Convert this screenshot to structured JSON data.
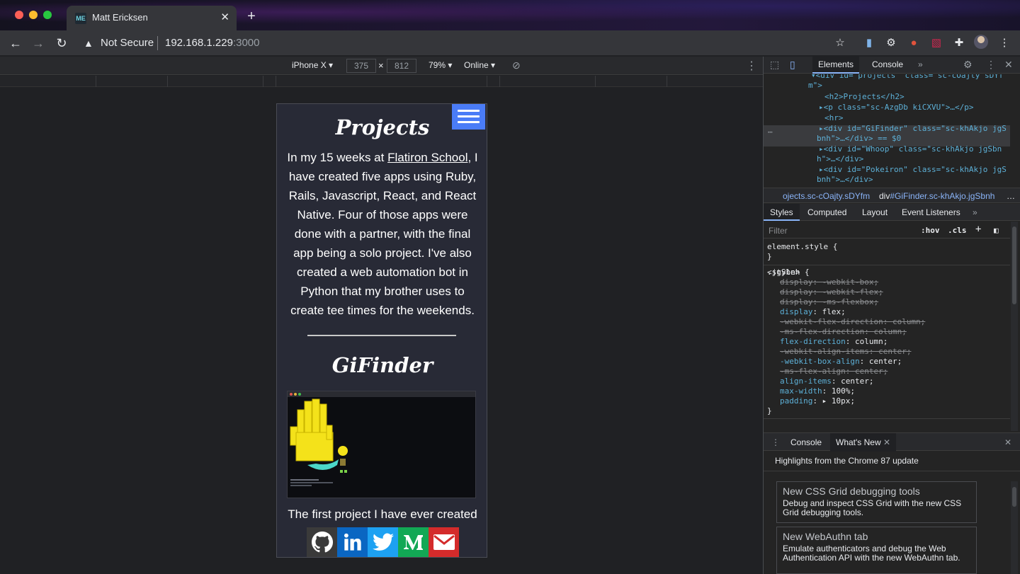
{
  "browser": {
    "tab_title": "Matt Ericksen",
    "tab_favicon": "ME",
    "security_label": "Not Secure",
    "url_host": "192.168.1.229",
    "url_port": ":3000"
  },
  "device_toolbar": {
    "device": "iPhone X",
    "width": "375",
    "height": "812",
    "zoom": "79%",
    "network": "Online"
  },
  "page": {
    "projects_title": "Projects",
    "projects_intro_before": "In my 15 weeks at ",
    "projects_link": "Flatiron School",
    "projects_intro_after": ", I have created five apps using Ruby, Rails, Javascript, React, and React Native. Four of those apps were done with a partner, with the final app being a solo project. I've also created a web automation bot in Python that my brother uses to create tee times for the weekends.",
    "gifinder_title": "GiFinder",
    "gifinder_text": "The first project I have ever created was ... this a ... y",
    "share_icons": [
      "github-icon",
      "linkedin-icon",
      "twitter-icon",
      "medium-icon",
      "email-icon"
    ]
  },
  "devtools": {
    "tabs": [
      "Elements",
      "Console"
    ],
    "active_tab": "Elements",
    "dom": [
      "▾<div id=\"projects\" class=\"sc-cOajty sDYf",
      "m\">",
      "<h2>Projects</h2>",
      "▸<p class=\"sc-AzgDb kiCXVU\">…</p>",
      "<hr>",
      "▸<div id=\"GiFinder\" class=\"sc-khAkjo jgS",
      "bnh\">…</div> == $0",
      "▸<div id=\"Whoop\" class=\"sc-khAkjo jgSbn",
      "h\">…</div>",
      "▸<div id=\"Pokeiron\" class=\"sc-khAkjo jgS",
      "bnh\">…</div>"
    ],
    "breadcrumb_1": "ojects.sc-cOajty.sDYfm",
    "breadcrumb_2_tag": "div",
    "breadcrumb_2_rest": "#GiFinder.sc-khAkjo.jgSbnh",
    "style_tabs": [
      "Styles",
      "Computed",
      "Layout",
      "Event Listeners"
    ],
    "filter_placeholder": "Filter",
    "filter_hov": ":hov",
    "filter_cls": ".cls",
    "element_style": "element.style {",
    "close_brace": "}",
    "rule_selector": ".jgSbnh {",
    "rule_source": "<style>",
    "declarations": [
      {
        "prop": "display",
        "value": "-webkit-box",
        "struck": true
      },
      {
        "prop": "display",
        "value": "-webkit-flex",
        "struck": true
      },
      {
        "prop": "display",
        "value": "-ms-flexbox",
        "struck": true
      },
      {
        "prop": "display",
        "value": "flex",
        "struck": false
      },
      {
        "prop": "-webkit-flex-direction",
        "value": "column",
        "struck": true
      },
      {
        "prop": "-ms-flex-direction",
        "value": "column",
        "struck": true
      },
      {
        "prop": "flex-direction",
        "value": "column",
        "struck": false
      },
      {
        "prop": "-webkit-align-items",
        "value": "center",
        "struck": true
      },
      {
        "prop": "-webkit-box-align",
        "value": "center",
        "struck": false
      },
      {
        "prop": "-ms-flex-align",
        "value": "center",
        "struck": true
      },
      {
        "prop": "align-items",
        "value": "center",
        "struck": false
      },
      {
        "prop": "max-width",
        "value": "100%",
        "struck": false
      },
      {
        "prop": "padding",
        "value": "▸ 10px",
        "struck": false
      }
    ],
    "drawer_tabs": [
      "Console",
      "What's New"
    ],
    "highlights": "Highlights from the Chrome 87 update",
    "news": [
      {
        "title": "New CSS Grid debugging tools",
        "body": "Debug and inspect CSS Grid with the new CSS Grid debugging tools."
      },
      {
        "title": "New WebAuthn tab",
        "body": "Emulate authenticators and debug the Web Authentication API with the new WebAuthn tab."
      }
    ]
  }
}
